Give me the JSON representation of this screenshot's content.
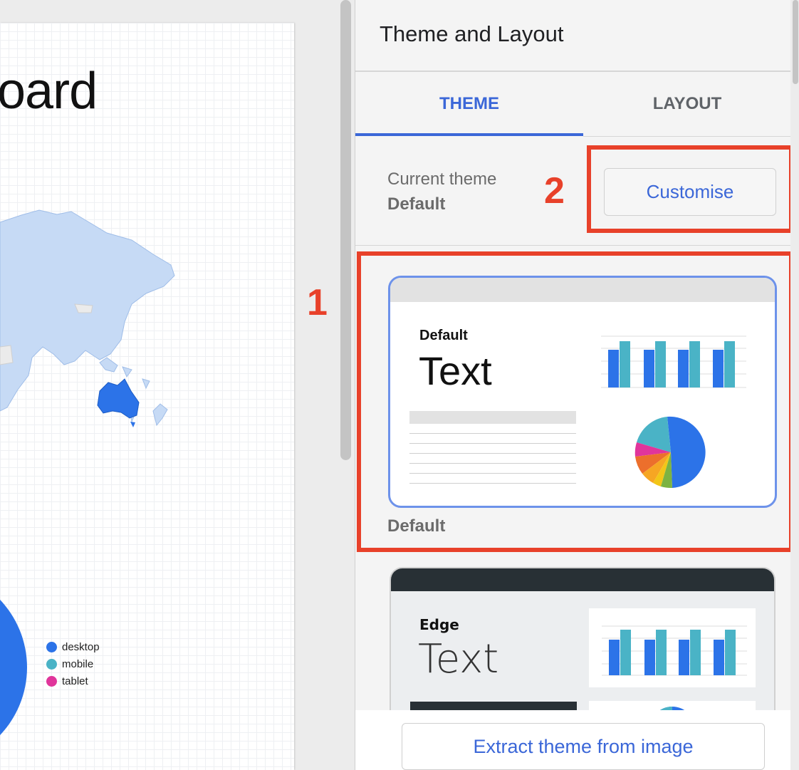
{
  "report": {
    "title_fragment": "oard",
    "legend": [
      {
        "label": "desktop",
        "color": "#2c73e8"
      },
      {
        "label": "mobile",
        "color": "#4ab3c6"
      },
      {
        "label": "tablet",
        "color": "#e0359b"
      }
    ]
  },
  "annotations": {
    "one": "1",
    "two": "2"
  },
  "panel": {
    "title": "Theme and Layout",
    "tabs": [
      {
        "label": "THEME",
        "active": true
      },
      {
        "label": "LAYOUT",
        "active": false
      }
    ],
    "current_theme_label": "Current theme",
    "current_theme_value": "Default",
    "customise_label": "Customise",
    "themes": [
      {
        "name": "Default",
        "sample_text": "Text",
        "caption": "Default"
      },
      {
        "name": "Edge",
        "sample_text": "Text"
      }
    ],
    "extract_label": "Extract theme from image"
  },
  "colors": {
    "accent": "#3b67d8",
    "annotation_red": "#e8412a",
    "bar_blue": "#2c73e8",
    "bar_teal": "#4ab3c6"
  }
}
